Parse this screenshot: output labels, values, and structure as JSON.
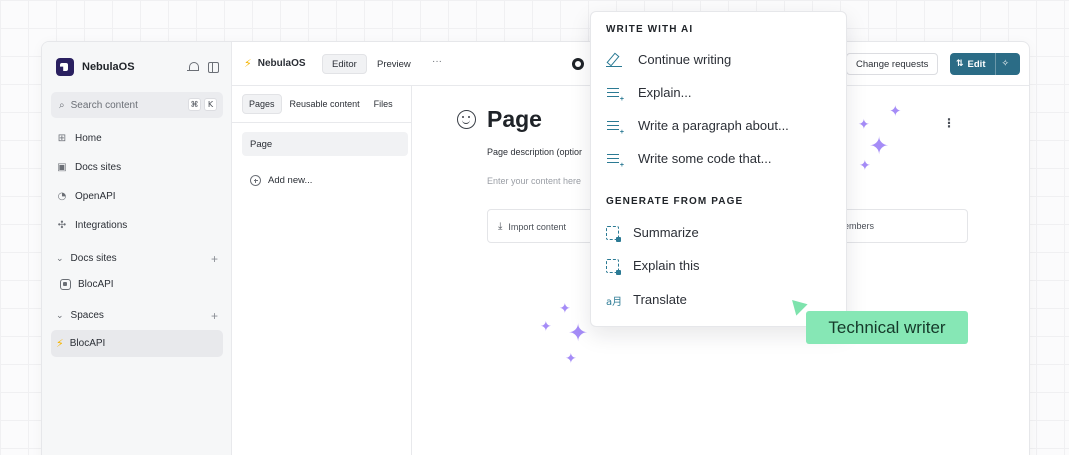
{
  "sidebar": {
    "brand": "NebulaOS",
    "search": {
      "placeholder": "Search content",
      "keys": [
        "⌘",
        "K"
      ]
    },
    "nav": [
      {
        "label": "Home",
        "icon": "grid-icon"
      },
      {
        "label": "Docs sites",
        "icon": "site-icon"
      },
      {
        "label": "OpenAPI",
        "icon": "api-icon"
      },
      {
        "label": "Integrations",
        "icon": "puzzle-icon"
      }
    ],
    "docs_sites_label": "Docs sites",
    "docs_sites_items": [
      {
        "label": "BlocAPI"
      }
    ],
    "spaces_label": "Spaces",
    "spaces_items": [
      {
        "label": "BlocAPI"
      }
    ]
  },
  "header": {
    "space_title": "NebulaOS",
    "tabs": [
      {
        "label": "Editor",
        "active": true
      },
      {
        "label": "Preview",
        "active": false
      }
    ],
    "more": "···",
    "change_requests": "Change requests",
    "edit": "Edit"
  },
  "pages_panel": {
    "tabs": [
      {
        "label": "Pages",
        "active": true
      },
      {
        "label": "Reusable content"
      },
      {
        "label": "Files"
      }
    ],
    "pages": [
      {
        "label": "Page"
      }
    ],
    "add_new": "Add new..."
  },
  "main": {
    "title": "Page",
    "description": "Page description (optior",
    "content_placeholder": "Enter your content here",
    "import_label": "Import content",
    "members_text": "embers"
  },
  "ai_menu": {
    "write_heading": "WRITE WITH AI",
    "write_items": [
      {
        "label": "Continue writing",
        "icon": "pen-icon"
      },
      {
        "label": "Explain...",
        "icon": "lines-plus-icon"
      },
      {
        "label": "Write a paragraph about...",
        "icon": "lines-plus-icon"
      },
      {
        "label": "Write some code that...",
        "icon": "lines-plus-icon"
      }
    ],
    "generate_heading": "GENERATE FROM PAGE",
    "generate_items": [
      {
        "label": "Summarize",
        "icon": "doc-icon"
      },
      {
        "label": "Explain this",
        "icon": "doc-icon"
      },
      {
        "label": "Translate",
        "icon": "translate-icon"
      }
    ],
    "translate_glyph": "a月"
  },
  "cursor_label": "Technical writer",
  "colors": {
    "accent": "#2b6c86",
    "sparkle": "#a58cf7",
    "cursor": "#86e7b5",
    "icon": "#2b7a94"
  }
}
